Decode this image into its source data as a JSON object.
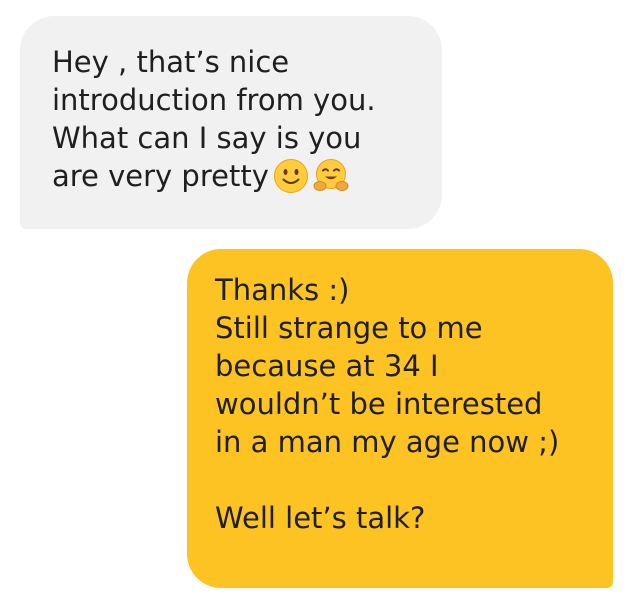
{
  "conversation": {
    "incoming_message": {
      "lines": [
        "Hey , that’s nice",
        "introduction from you.",
        "What can I say is you",
        "are very pretty"
      ],
      "emojis": [
        "slightly-smiling-face-icon",
        "hugging-face-icon"
      ]
    },
    "outgoing_message": {
      "lines": [
        "Thanks :)",
        "Still strange to me",
        "because at 34 I",
        "wouldn’t be interested",
        "in a man my age now ;)",
        "",
        "Well let’s talk?"
      ]
    }
  },
  "colors": {
    "incoming_bubble": "#f1f1f1",
    "outgoing_bubble": "#fdc323",
    "text": "#1f1f1f",
    "emoji_face": "#ffcc3d"
  }
}
